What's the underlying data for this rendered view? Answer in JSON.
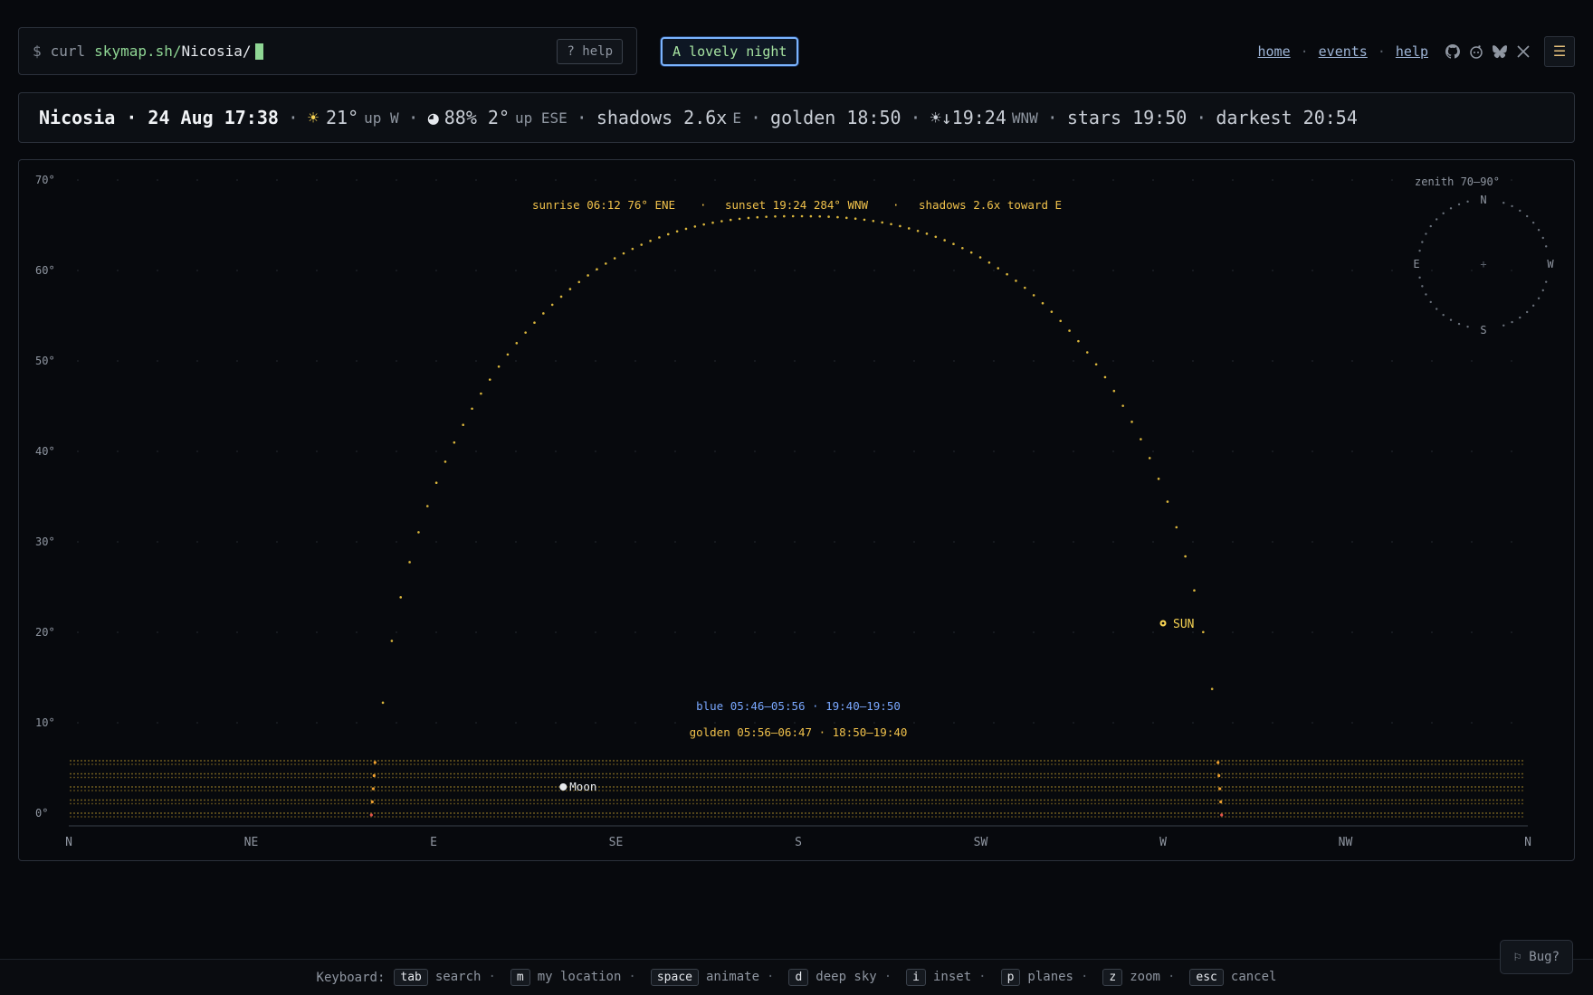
{
  "command": {
    "prompt": "$",
    "cmd": "curl",
    "domain": "skymap.sh/",
    "city": "Nicosia/",
    "help_label": "? help"
  },
  "badge": "A lovely night",
  "nav": {
    "home": "home",
    "events": "events",
    "help": "help",
    "sep": "·",
    "menu_icon": "☰"
  },
  "info": {
    "title": "Nicosia · 24 Aug 17:38",
    "sun_sym": "☀",
    "sun_alt": "21°",
    "sun_dir": "up W",
    "moon_sym": "◕",
    "moon_illum_alt": "88% 2°",
    "moon_dir": "up ESE",
    "shadows": "shadows 2.6x",
    "shadows_dir": "E",
    "golden": "golden 18:50",
    "sunset": "☀↓19:24",
    "sunset_dir": "WNW",
    "stars": "stars 19:50",
    "darkest": "darkest 20:54",
    "sep": "·"
  },
  "chart_data": {
    "type": "scatter",
    "y_ticks": [
      "70°",
      "60°",
      "50°",
      "40°",
      "30°",
      "20°",
      "10°",
      "0°"
    ],
    "y_values": [
      70,
      60,
      50,
      40,
      30,
      20,
      10,
      0
    ],
    "ylim": [
      0,
      70
    ],
    "x_ticks": [
      "N",
      "NE",
      "E",
      "SE",
      "S",
      "SW",
      "W",
      "NW",
      "N"
    ],
    "x_values": [
      0,
      45,
      90,
      135,
      180,
      225,
      270,
      315,
      360
    ],
    "xlim": [
      0,
      360
    ],
    "grid": true,
    "sun_path": {
      "rise_az": 76,
      "set_az": 284,
      "peak_alt": 66
    },
    "sun": {
      "label": "SUN",
      "az": 270,
      "alt": 21
    },
    "moon": {
      "label": "Moon",
      "az": 122,
      "alt": 2
    },
    "annotations": {
      "sunrise": "sunrise 06:12  76° ENE",
      "sunset": "sunset 19:24  284° WNW",
      "shadows": "shadows 2.6x toward E",
      "sep": "·",
      "blue": "blue 05:46–05:56 · 19:40–19:50",
      "golden": "golden 05:56–06:47 · 18:50–19:40"
    },
    "zenith_inset": {
      "title": "zenith 70–90°",
      "n": "N",
      "s": "S",
      "e": "E",
      "w": "W",
      "center": "+"
    },
    "colors": {
      "sun": "#f7d353",
      "path": "#d9b53c",
      "blue": "#7aa8ff",
      "golden": "#f0c14b",
      "grid": "#2a2f36",
      "horizon": "#b8962e",
      "axis_label": "#8f96a1"
    }
  },
  "footer": {
    "prefix": "Keyboard:",
    "items": [
      {
        "key": "tab",
        "label": "search"
      },
      {
        "key": "m",
        "label": "my location"
      },
      {
        "key": "space",
        "label": "animate"
      },
      {
        "key": "d",
        "label": "deep sky"
      },
      {
        "key": "i",
        "label": "inset"
      },
      {
        "key": "p",
        "label": "planes"
      },
      {
        "key": "z",
        "label": "zoom"
      },
      {
        "key": "esc",
        "label": "cancel"
      }
    ],
    "sep": "·"
  },
  "bug_label": "⚐ Bug?"
}
